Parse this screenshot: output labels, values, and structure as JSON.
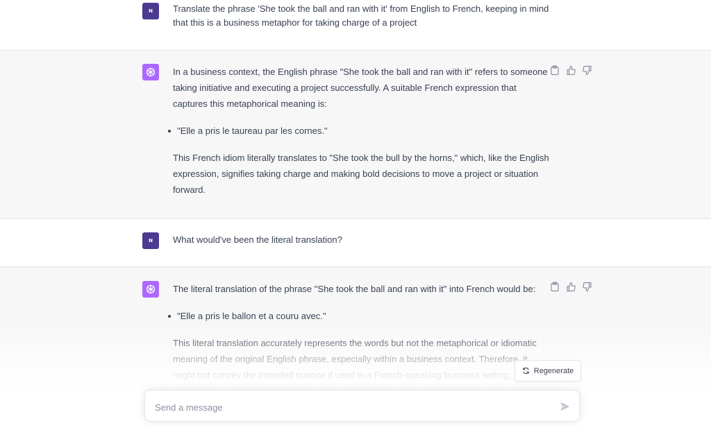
{
  "messages": [
    {
      "role": "user",
      "text": "Translate the phrase 'She took the ball and ran with it' from English to French, keeping in mind that this is a business metaphor for taking charge of a project"
    },
    {
      "role": "assistant",
      "paragraphs": [
        "In a business context, the English phrase \"She took the ball and ran with it\" refers to someone taking initiative and executing a project successfully. A suitable French expression that captures this metaphorical meaning is:",
        "\"Elle a pris le taureau par les cornes.\"",
        "This French idiom literally translates to \"She took the bull by the horns,\" which, like the English expression, signifies taking charge and making bold decisions to move a project or situation forward."
      ]
    },
    {
      "role": "user",
      "text": "What would've been the literal translation?"
    },
    {
      "role": "assistant",
      "paragraphs": [
        "The literal translation of the phrase \"She took the ball and ran with it\" into French would be:",
        "\"Elle a pris le ballon et a couru avec.\"",
        "This literal translation accurately represents the words but not the metaphorical or idiomatic meaning of the original English phrase, especially within a business context. Therefore, it might not convey the intended nuance if used in a French-speaking business setting."
      ]
    }
  ],
  "regenerate_label": "Regenerate",
  "composer": {
    "placeholder": "Send a message"
  },
  "icons": {
    "user_avatar": "user-avatar-icon",
    "bot_avatar": "openai-logo-icon",
    "copy": "clipboard-icon",
    "thumbs_up": "thumbs-up-icon",
    "thumbs_down": "thumbs-down-icon",
    "regenerate": "refresh-icon",
    "send": "send-icon"
  },
  "colors": {
    "bot_avatar": "#ab68ff",
    "user_avatar": "#4b3a8f",
    "bot_row_bg": "#f7f7f8"
  }
}
